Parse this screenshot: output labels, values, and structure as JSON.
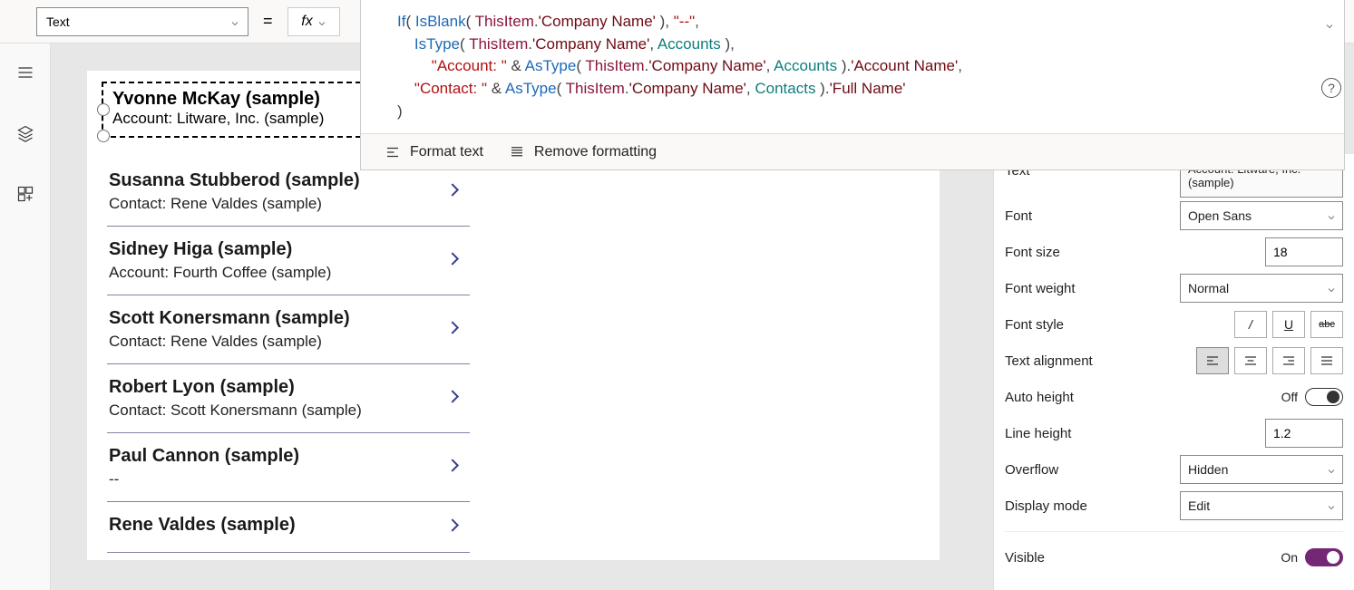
{
  "propertyDropdown": {
    "value": "Text"
  },
  "formula": {
    "tokens": [
      [
        [
          "kw",
          "If"
        ],
        [
          "punc",
          "( "
        ],
        [
          "kw",
          "IsBlank"
        ],
        [
          "punc",
          "( "
        ],
        [
          "id",
          "ThisItem"
        ],
        [
          "punc",
          "."
        ],
        [
          "prop",
          "'Company Name'"
        ],
        [
          "punc",
          " ), "
        ],
        [
          "str",
          "\"--\""
        ],
        [
          "punc",
          ","
        ]
      ],
      [
        [
          "punc",
          "    "
        ],
        [
          "kw",
          "IsType"
        ],
        [
          "punc",
          "( "
        ],
        [
          "id",
          "ThisItem"
        ],
        [
          "punc",
          "."
        ],
        [
          "prop",
          "'Company Name'"
        ],
        [
          "punc",
          ", "
        ],
        [
          "type",
          "Accounts"
        ],
        [
          "punc",
          " ),"
        ]
      ],
      [
        [
          "punc",
          "        "
        ],
        [
          "str",
          "\"Account: \""
        ],
        [
          "punc",
          " & "
        ],
        [
          "kw",
          "AsType"
        ],
        [
          "punc",
          "( "
        ],
        [
          "id",
          "ThisItem"
        ],
        [
          "punc",
          "."
        ],
        [
          "prop",
          "'Company Name'"
        ],
        [
          "punc",
          ", "
        ],
        [
          "type",
          "Accounts"
        ],
        [
          "punc",
          " )."
        ],
        [
          "prop",
          "'Account Name'"
        ],
        [
          "punc",
          ","
        ]
      ],
      [
        [
          "punc",
          "    "
        ],
        [
          "str",
          "\"Contact: \""
        ],
        [
          "punc",
          " & "
        ],
        [
          "kw",
          "AsType"
        ],
        [
          "punc",
          "( "
        ],
        [
          "id",
          "ThisItem"
        ],
        [
          "punc",
          "."
        ],
        [
          "prop",
          "'Company Name'"
        ],
        [
          "punc",
          ", "
        ],
        [
          "type",
          "Contacts"
        ],
        [
          "punc",
          " )."
        ],
        [
          "prop",
          "'Full Name'"
        ]
      ],
      [
        [
          "punc",
          ")"
        ]
      ]
    ]
  },
  "editorToolbar": {
    "formatText": "Format text",
    "removeFormatting": "Remove formatting"
  },
  "selectedItem": {
    "title": "Yvonne McKay (sample)",
    "sub": "Account: Litware, Inc. (sample)"
  },
  "gallery": [
    {
      "title": "Susanna Stubberod (sample)",
      "sub": "Contact: Rene Valdes (sample)"
    },
    {
      "title": "Sidney Higa (sample)",
      "sub": "Account: Fourth Coffee (sample)"
    },
    {
      "title": "Scott Konersmann (sample)",
      "sub": "Contact: Rene Valdes (sample)"
    },
    {
      "title": "Robert Lyon (sample)",
      "sub": "Contact: Scott Konersmann (sample)"
    },
    {
      "title": "Paul Cannon (sample)",
      "sub": "--"
    },
    {
      "title": "Rene Valdes (sample)",
      "sub": ""
    }
  ],
  "props": {
    "textLabel": "Text",
    "textValue": "Account: Litware, Inc. (sample)",
    "fontLabel": "Font",
    "fontValue": "Open Sans",
    "fontSizeLabel": "Font size",
    "fontSizeValue": "18",
    "fontWeightLabel": "Font weight",
    "fontWeightValue": "Normal",
    "fontStyleLabel": "Font style",
    "italicGlyph": "/",
    "underlineGlyph": "U",
    "strikeGlyph": "abc",
    "textAlignLabel": "Text alignment",
    "autoHeightLabel": "Auto height",
    "autoHeightValue": "Off",
    "lineHeightLabel": "Line height",
    "lineHeightValue": "1.2",
    "overflowLabel": "Overflow",
    "overflowValue": "Hidden",
    "displayModeLabel": "Display mode",
    "displayModeValue": "Edit",
    "visibleLabel": "Visible",
    "visibleValue": "On"
  }
}
